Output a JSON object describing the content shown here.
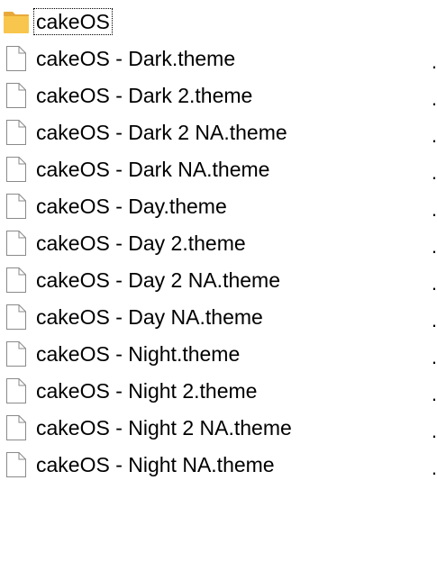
{
  "folder": {
    "name": "cakeOS",
    "icon": "folder-icon",
    "color": "#F8C64C"
  },
  "files": [
    {
      "name": "cakeOS - Dark.theme",
      "trailing": "."
    },
    {
      "name": "cakeOS - Dark 2.theme",
      "trailing": "."
    },
    {
      "name": "cakeOS - Dark 2 NA.theme",
      "trailing": "."
    },
    {
      "name": "cakeOS - Dark NA.theme",
      "trailing": "."
    },
    {
      "name": "cakeOS - Day.theme",
      "trailing": "."
    },
    {
      "name": "cakeOS - Day 2.theme",
      "trailing": "."
    },
    {
      "name": "cakeOS - Day 2 NA.theme",
      "trailing": "."
    },
    {
      "name": "cakeOS - Day NA.theme",
      "trailing": "."
    },
    {
      "name": "cakeOS - Night.theme",
      "trailing": "."
    },
    {
      "name": "cakeOS - Night 2.theme",
      "trailing": "."
    },
    {
      "name": "cakeOS - Night 2 NA.theme",
      "trailing": "."
    },
    {
      "name": "cakeOS - Night NA.theme",
      "trailing": "."
    }
  ]
}
